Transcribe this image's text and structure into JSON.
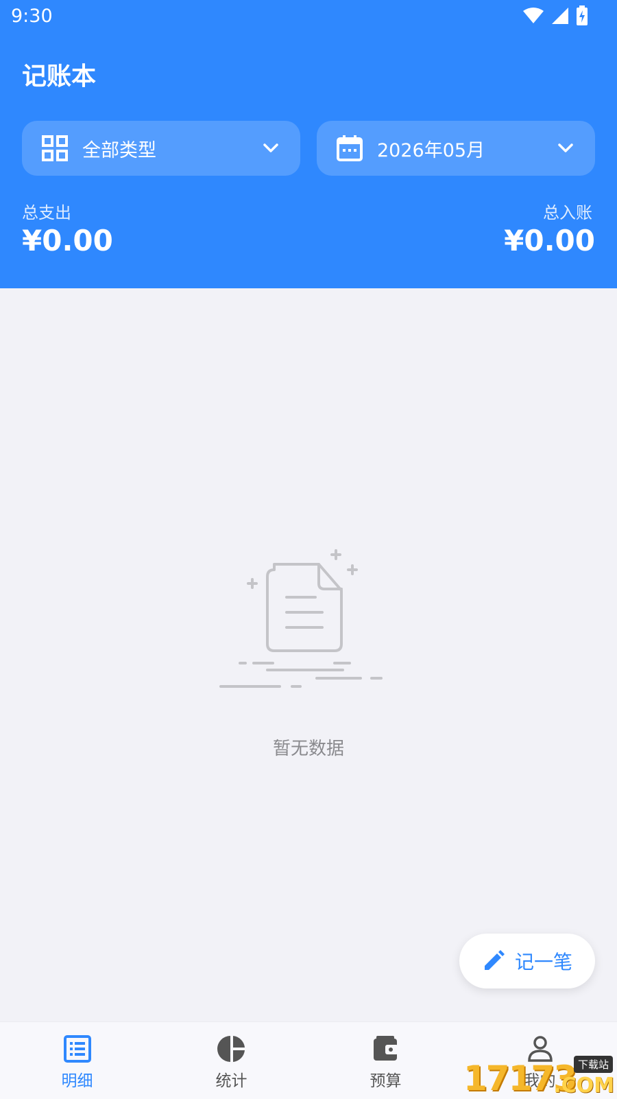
{
  "status_bar": {
    "time": "9:30",
    "icons": [
      "wifi-icon",
      "cellular-signal-icon",
      "battery-charging-icon"
    ]
  },
  "header": {
    "title": "记账本",
    "type_filter": {
      "label": "全部类型",
      "icon": "grid-icon"
    },
    "date_filter": {
      "label": "2026年05月",
      "icon": "calendar-icon"
    },
    "expense": {
      "label": "总支出",
      "value": "¥0.00"
    },
    "income": {
      "label": "总入账",
      "value": "¥0.00"
    }
  },
  "empty_state": {
    "icon": "empty-document-icon",
    "text": "暂无数据"
  },
  "fab": {
    "label": "记一笔",
    "icon": "pencil-icon"
  },
  "bottom_nav": {
    "items": [
      {
        "label": "明细",
        "icon": "list-icon",
        "active": true
      },
      {
        "label": "统计",
        "icon": "pie-chart-icon",
        "active": false
      },
      {
        "label": "预算",
        "icon": "wallet-icon",
        "active": false
      },
      {
        "label": "我的",
        "icon": "person-icon",
        "active": false
      }
    ]
  },
  "watermark": {
    "number": "17173",
    "badge": "下载站",
    "domain": ".COM"
  },
  "colors": {
    "primary": "#2f88fe",
    "background": "#f2f2f7",
    "nav_inactive": "#555555",
    "empty_text": "#8a8a8e"
  }
}
